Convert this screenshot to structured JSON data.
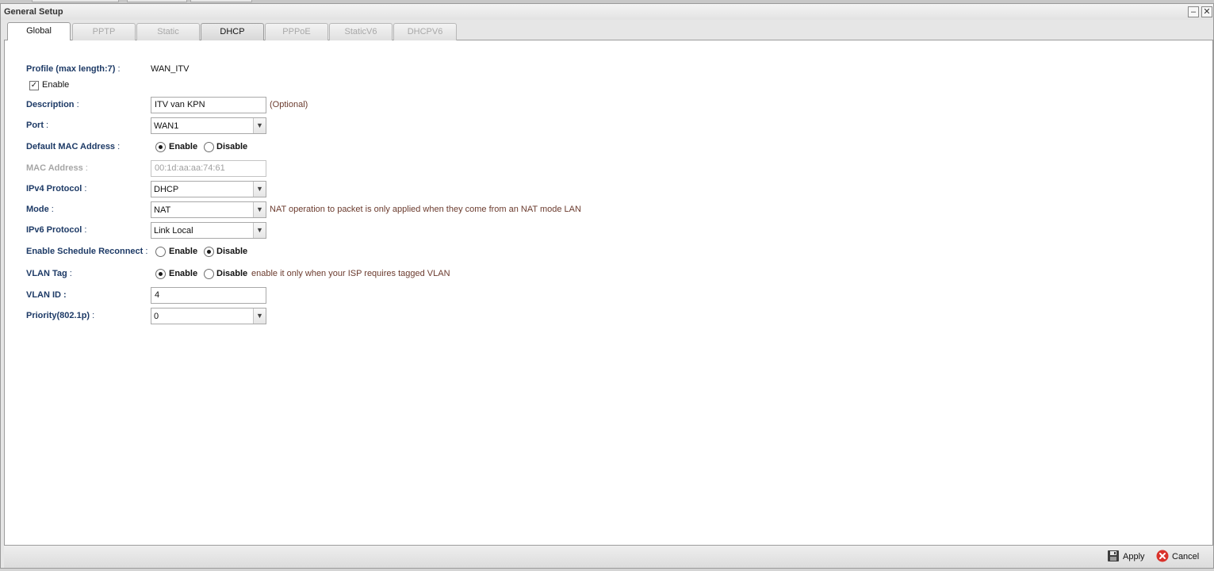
{
  "window": {
    "title": "General Setup",
    "minimize_glyph": "–",
    "close_glyph": "✕"
  },
  "tabs": [
    {
      "label": "Global",
      "state": "active"
    },
    {
      "label": "PPTP",
      "state": "disabled"
    },
    {
      "label": "Static",
      "state": "disabled"
    },
    {
      "label": "DHCP",
      "state": "enabled"
    },
    {
      "label": "PPPoE",
      "state": "disabled"
    },
    {
      "label": "StaticV6",
      "state": "disabled"
    },
    {
      "label": "DHCPV6",
      "state": "disabled"
    }
  ],
  "form": {
    "profile": {
      "label": "Profile (max length:7)",
      "colon": " :",
      "value": "WAN_ITV"
    },
    "enable": {
      "label": "Enable",
      "checked": true,
      "check_glyph": "✓"
    },
    "description": {
      "label": "Description",
      "colon": " :",
      "value": "ITV van KPN",
      "hint": "(Optional)"
    },
    "port": {
      "label": "Port",
      "colon": " :",
      "value": "WAN1"
    },
    "default_mac": {
      "label": "Default MAC Address",
      "colon": " :",
      "options": [
        "Enable",
        "Disable"
      ],
      "selected": "Enable"
    },
    "mac_address": {
      "label": "MAC Address",
      "colon": " :",
      "value": "00:1d:aa:aa:74:61"
    },
    "ipv4_protocol": {
      "label": "IPv4 Protocol",
      "colon": " :",
      "value": "DHCP"
    },
    "mode": {
      "label": "Mode",
      "colon": " :",
      "value": "NAT",
      "hint": "NAT operation to packet is only applied when they come from an NAT mode LAN"
    },
    "ipv6_protocol": {
      "label": "IPv6 Protocol",
      "colon": " :",
      "value": "Link Local"
    },
    "schedule_reconnect": {
      "label": "Enable Schedule Reconnect",
      "colon": " :",
      "options": [
        "Enable",
        "Disable"
      ],
      "selected": "Disable"
    },
    "vlan_tag": {
      "label": "VLAN Tag",
      "colon": " :",
      "options": [
        "Enable",
        "Disable"
      ],
      "selected": "Enable",
      "hint": "enable it only when your ISP requires tagged VLAN"
    },
    "vlan_id": {
      "label": "VLAN ID :",
      "value": "4"
    },
    "priority": {
      "label": "Priority(802.1p)",
      "colon": " :",
      "value": "0"
    }
  },
  "dropdown_glyph": "▼",
  "footer": {
    "apply_label": "Apply",
    "cancel_label": "Cancel",
    "apply_icon": "save-icon",
    "cancel_icon": "cancel-icon"
  },
  "colors": {
    "label": "#1d3a66",
    "hint": "#6b3b2e",
    "cancel_icon": "#d9322b"
  }
}
